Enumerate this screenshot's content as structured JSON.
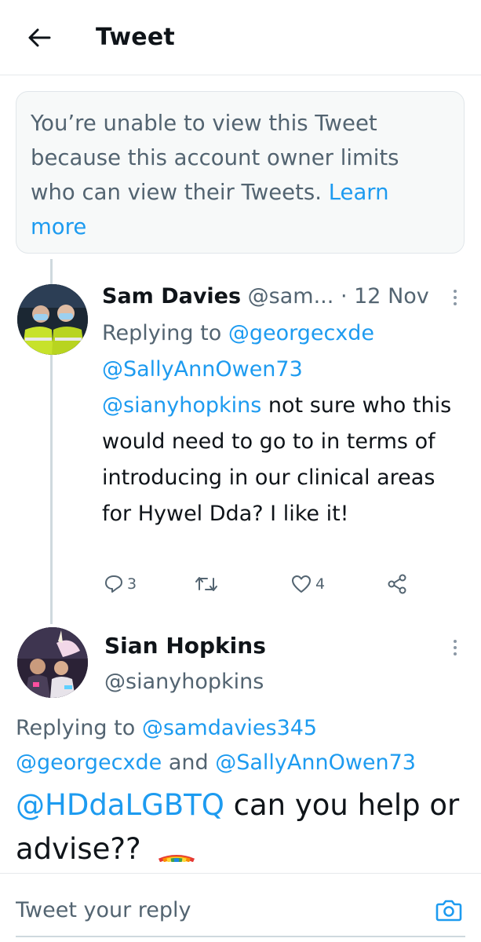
{
  "header": {
    "title": "Tweet",
    "back_icon": "arrow-left-icon"
  },
  "notice": {
    "text": "You’re unable to view this Tweet because this account owner limits who can view their Tweets.",
    "link": "Learn more"
  },
  "tweet1": {
    "name": "Sam Davies",
    "handle": "@sam...",
    "dot": "·",
    "date": "12 Nov",
    "replying_label": "Replying to",
    "mention1": "@georgecxde",
    "mention2": "@SallyAnnOwen73",
    "mention3": "@sianyhopkins",
    "text": "not sure who this would need to go to in terms of introducing in our clinical areas for Hywel Dda?  I like it!",
    "reply_count": "3",
    "retweet_count": "",
    "like_count": "4"
  },
  "tweet2": {
    "name": "Sian Hopkins",
    "handle": "@sianyhopkins",
    "replying_label": "Replying to",
    "mention1": "@samdavies345",
    "mention2": "@georgecxde",
    "and": "and",
    "mention3": "@SallyAnnOwen73",
    "mention4": "@HDdaLGBTQ",
    "text": "can you help or advise??",
    "emoji": "rainbow"
  },
  "composer": {
    "placeholder": "Tweet your reply",
    "camera_icon": "camera-icon"
  },
  "colors": {
    "link": "#1d9bf0",
    "muted": "#536471",
    "text": "#0f1419"
  }
}
